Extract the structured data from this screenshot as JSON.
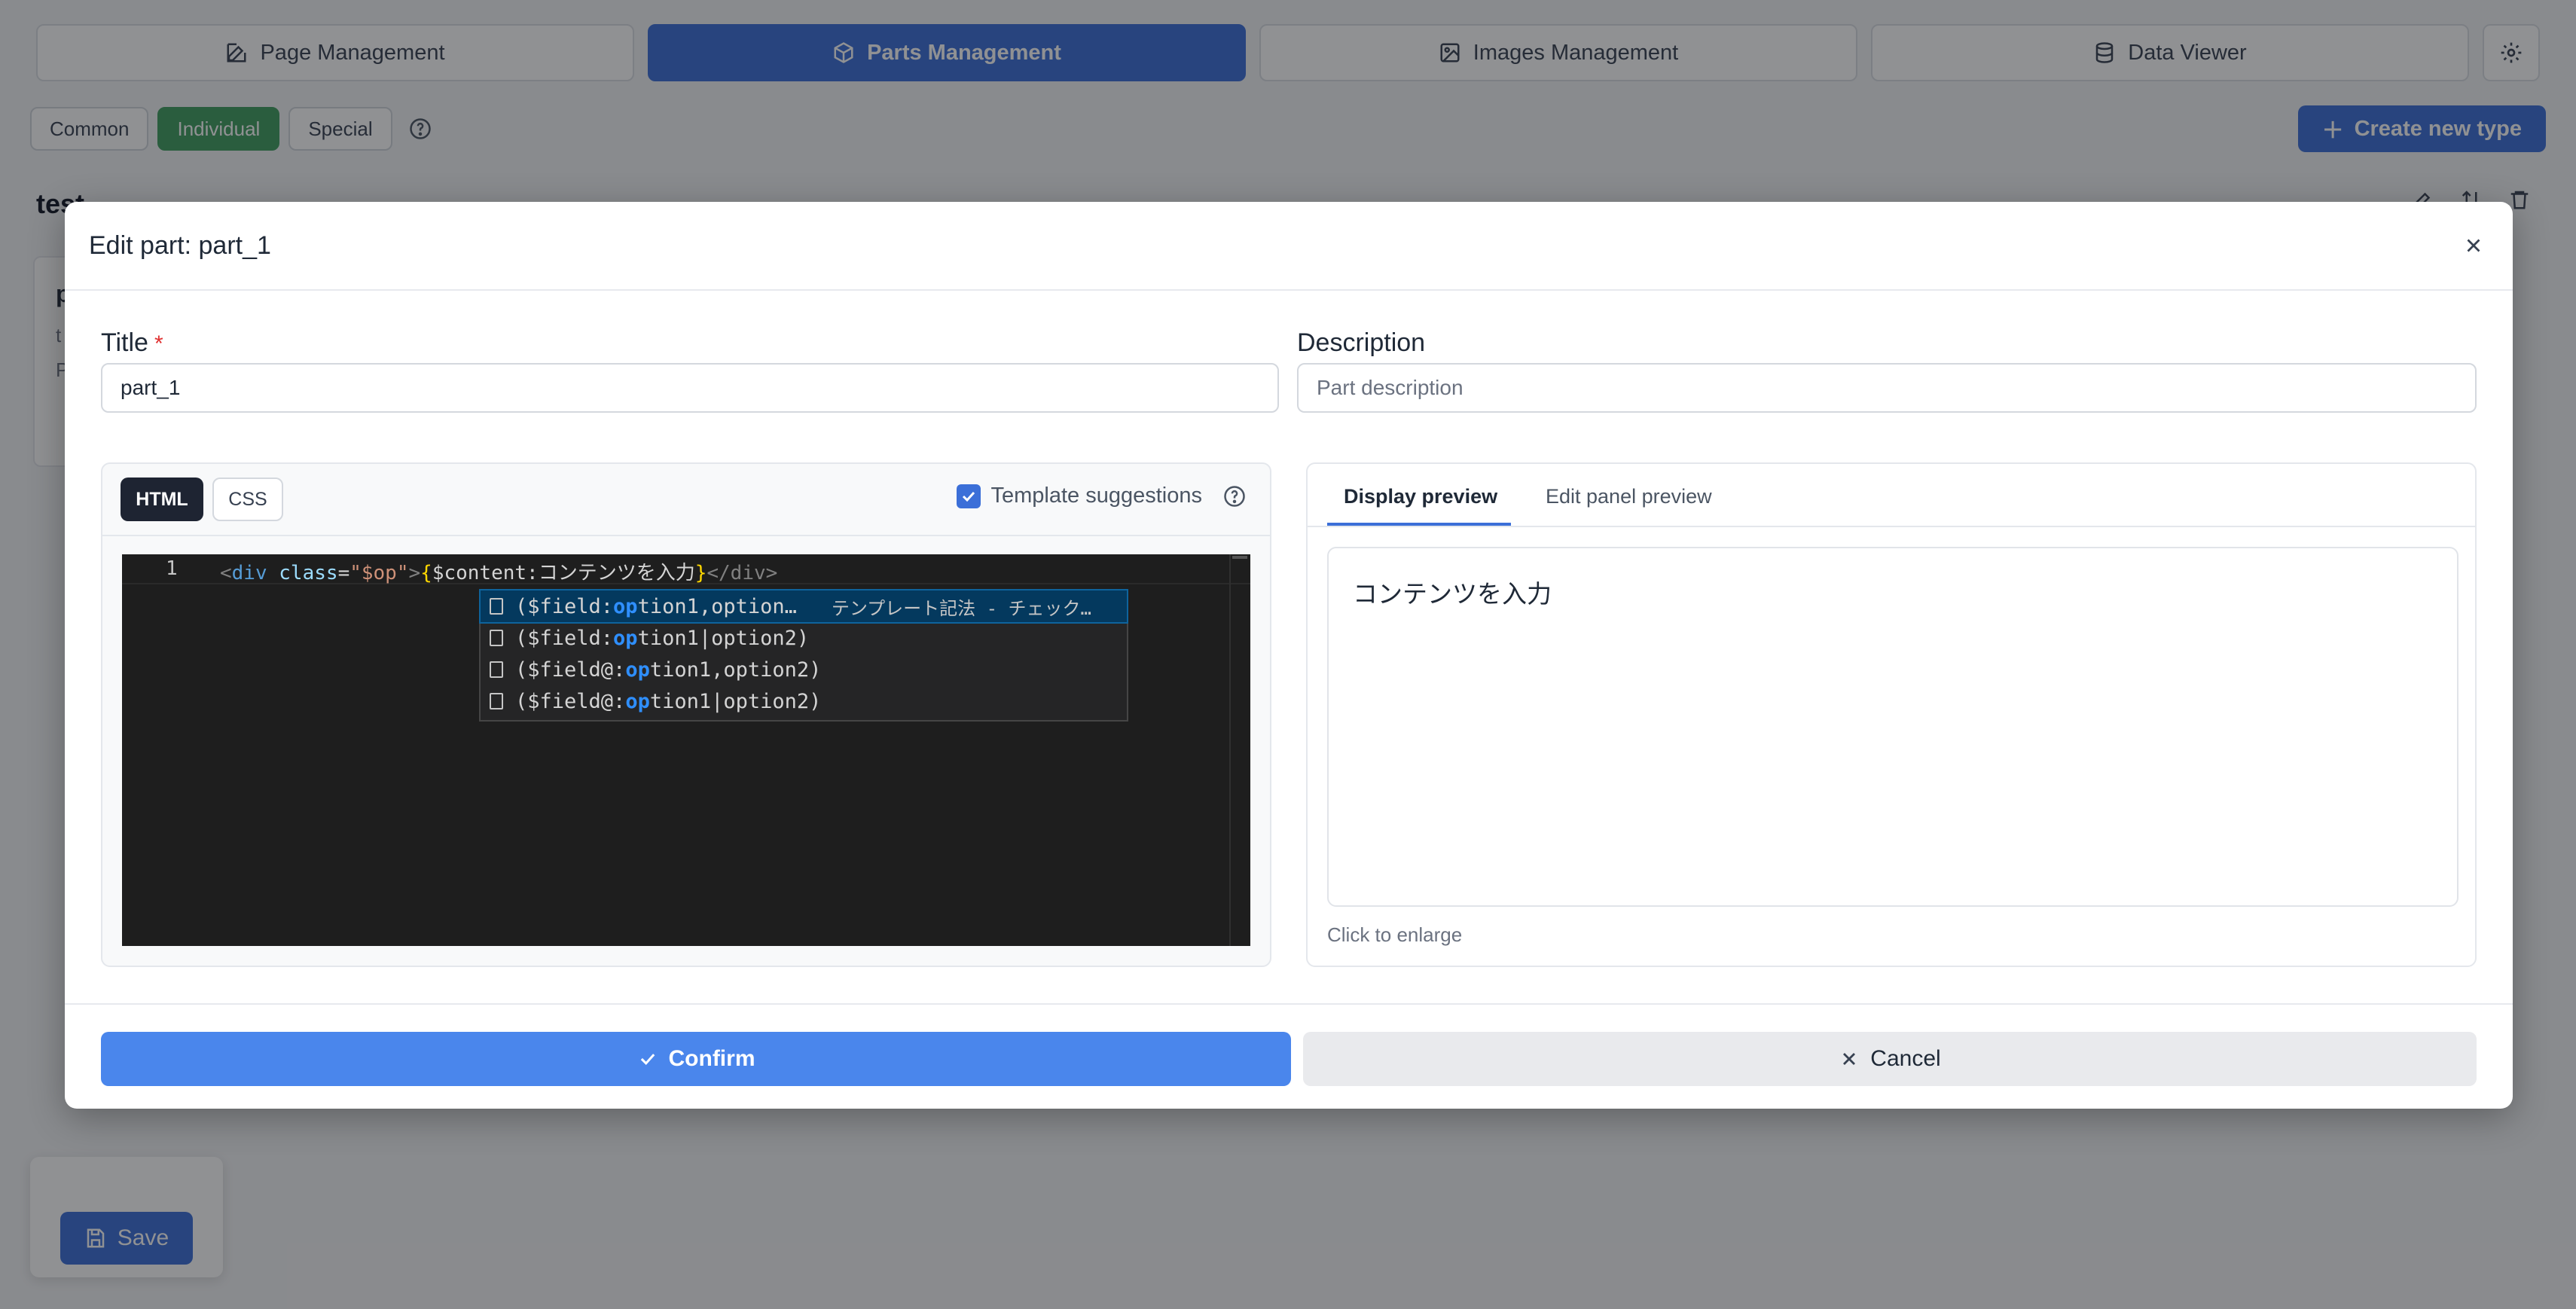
{
  "nav": {
    "tabs": [
      {
        "label": "Page Management",
        "icon": "edit-icon"
      },
      {
        "label": "Parts Management",
        "icon": "box-icon",
        "active": true
      },
      {
        "label": "Images Management",
        "icon": "image-icon"
      },
      {
        "label": "Data Viewer",
        "icon": "database-icon"
      }
    ],
    "settings_icon": "gear-icon"
  },
  "filters": {
    "items": [
      "Common",
      "Individual",
      "Special"
    ],
    "active": "Individual",
    "create_label": "Create new type"
  },
  "background": {
    "section_title": "test",
    "card_title": "p",
    "card_line1": "t",
    "card_line2": "P"
  },
  "save_label": "Save",
  "modal": {
    "title": "Edit part: part_1",
    "title_field": {
      "label": "Title",
      "required_mark": "*",
      "value": "part_1"
    },
    "description_field": {
      "label": "Description",
      "placeholder": "Part description",
      "value": ""
    },
    "editor": {
      "tabs": [
        "HTML",
        "CSS"
      ],
      "active_tab": "HTML",
      "template_suggestions_label": "Template suggestions",
      "template_suggestions_checked": true,
      "line_number": "1",
      "code_parts": {
        "lt": "<",
        "tag": "div",
        "space": " ",
        "attr": "class",
        "eq": "=",
        "str": "\"$op\"",
        "gt": ">",
        "brace_open": "{",
        "content": "$content:コンテンツを入力",
        "brace_close": "}",
        "close_tag": "</div>"
      },
      "suggestions": [
        {
          "pre": "($field:",
          "match": "op",
          "post": "tion1,option…",
          "detail": "テンプレート記法 - チェック…",
          "selected": true
        },
        {
          "pre": "($field:",
          "match": "op",
          "post": "tion1|option2)",
          "detail": ""
        },
        {
          "pre": "($field@:",
          "match": "op",
          "post": "tion1,option2)",
          "detail": ""
        },
        {
          "pre": "($field@:",
          "match": "op",
          "post": "tion1|option2)",
          "detail": ""
        }
      ]
    },
    "preview": {
      "tabs": [
        "Display preview",
        "Edit panel preview"
      ],
      "active_tab": "Display preview",
      "content": "コンテンツを入力",
      "hint": "Click to enlarge"
    },
    "confirm_label": "Confirm",
    "cancel_label": "Cancel"
  }
}
